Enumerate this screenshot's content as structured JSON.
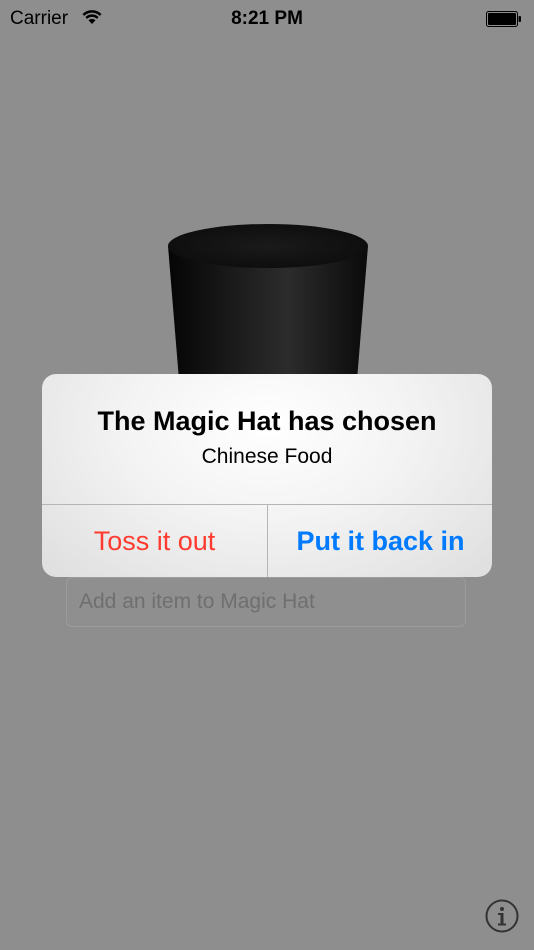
{
  "status_bar": {
    "carrier": "Carrier",
    "time": "8:21 PM",
    "wifi_icon": "wifi-icon",
    "battery_icon": "battery-icon"
  },
  "alert": {
    "title": "The Magic Hat has chosen",
    "message": "Chinese Food",
    "toss_label": "Toss it out",
    "put_back_label": "Put it back in"
  },
  "add_item": {
    "placeholder": "Add an item to Magic Hat",
    "value": ""
  },
  "info_icon": "info-icon",
  "colors": {
    "background": "#8e8e8e",
    "destructive": "#ff3b30",
    "accent": "#007aff"
  }
}
